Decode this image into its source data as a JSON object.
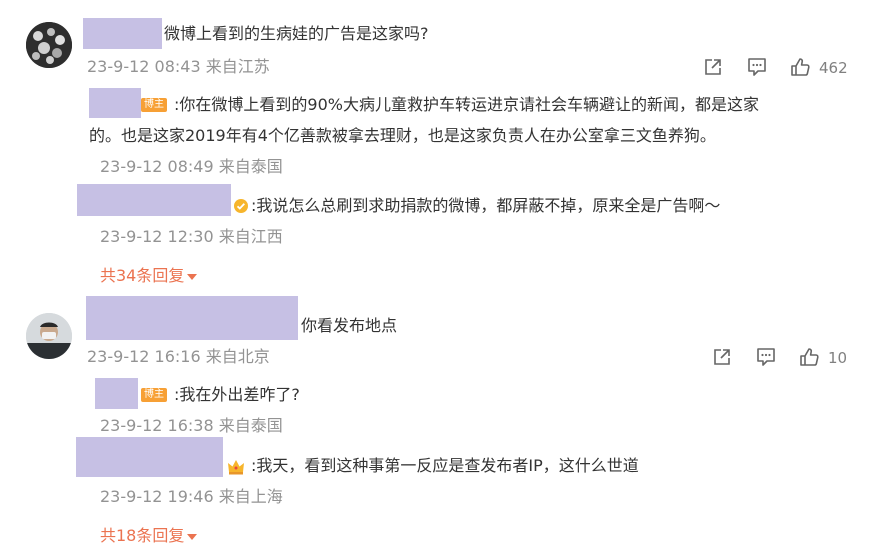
{
  "colors": {
    "accent": "#eb7350",
    "badge": "#f7a035",
    "redacted": "#c6c0e4",
    "meta": "#939393"
  },
  "comments": [
    {
      "text": "微博上看到的生病娃的广告是这家吗?",
      "meta": "23-9-12 08:43 来自江苏",
      "like_count": "462",
      "replies": [
        {
          "badge": "博主",
          "text_line1": ":你在微博上看到的90%大病儿童救护车转运进京请社会车辆避让的新闻，都是这家",
          "text_line2": "的。也是这家2019年有4个亿善款被拿去理财，也是这家负责人在办公室拿三文鱼养狗。",
          "meta": "23-9-12 08:49 来自泰国"
        },
        {
          "text": ":我说怎么总刷到求助捐款的微博，都屏蔽不掉，原来全是广告啊～",
          "meta": "23-9-12 12:30 来自江西"
        }
      ],
      "more_replies": "共34条回复"
    },
    {
      "text": "你看发布地点",
      "meta": "23-9-12 16:16 来自北京",
      "like_count": "10",
      "replies": [
        {
          "badge": "博主",
          "text": ":我在外出差咋了?",
          "meta": "23-9-12 16:38 来自泰国"
        },
        {
          "text": ":我天，看到这种事第一反应是查发布者IP，这什么世道",
          "meta": "23-9-12 19:46 来自上海"
        }
      ],
      "more_replies": "共18条回复"
    }
  ]
}
